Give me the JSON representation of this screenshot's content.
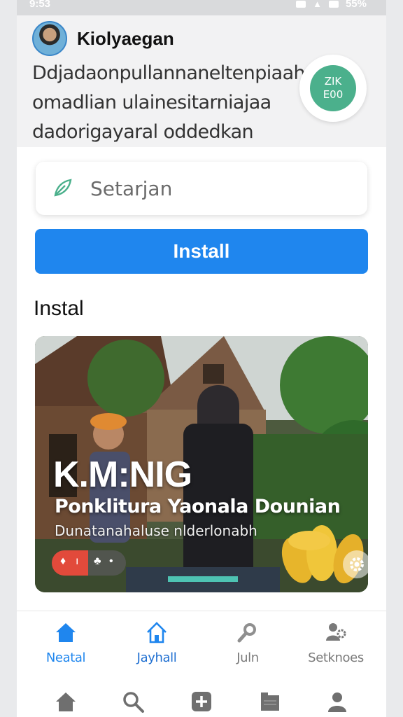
{
  "status_bar": {
    "time": "9:53",
    "battery": "55%"
  },
  "header": {
    "app_name": "Kiolyaegan",
    "description": "Ddjadaonpullannaneltenpiaah omadlian ulainesitarniajaa dadorigayaral oddedkan",
    "badge_line1": "ZIK",
    "badge_line2": "E00"
  },
  "search": {
    "placeholder": "Setarjan",
    "icon": "pencil-leaf-icon"
  },
  "install_button": {
    "label": "Install"
  },
  "section": {
    "title": "Instal"
  },
  "hero": {
    "title": "K.M:NIG",
    "subtitle": "Ponklitura Yaonala Dounian",
    "caption": "Dunatanahaluse nlderlonabh"
  },
  "tabs": [
    {
      "label": "Neatal",
      "icon": "home-icon",
      "active": true
    },
    {
      "label": "Jayhall",
      "icon": "house-outline-icon",
      "active": false
    },
    {
      "label": "Juln",
      "icon": "microphone-icon",
      "active": false
    },
    {
      "label": "Setknoes",
      "icon": "settings-people-icon",
      "active": false
    }
  ],
  "navbar": [
    "home-icon",
    "search-icon",
    "add-icon",
    "library-icon",
    "profile-icon"
  ],
  "colors": {
    "accent": "#1f86ee",
    "badge": "#4bb08c",
    "pill": "#e24a3b"
  }
}
